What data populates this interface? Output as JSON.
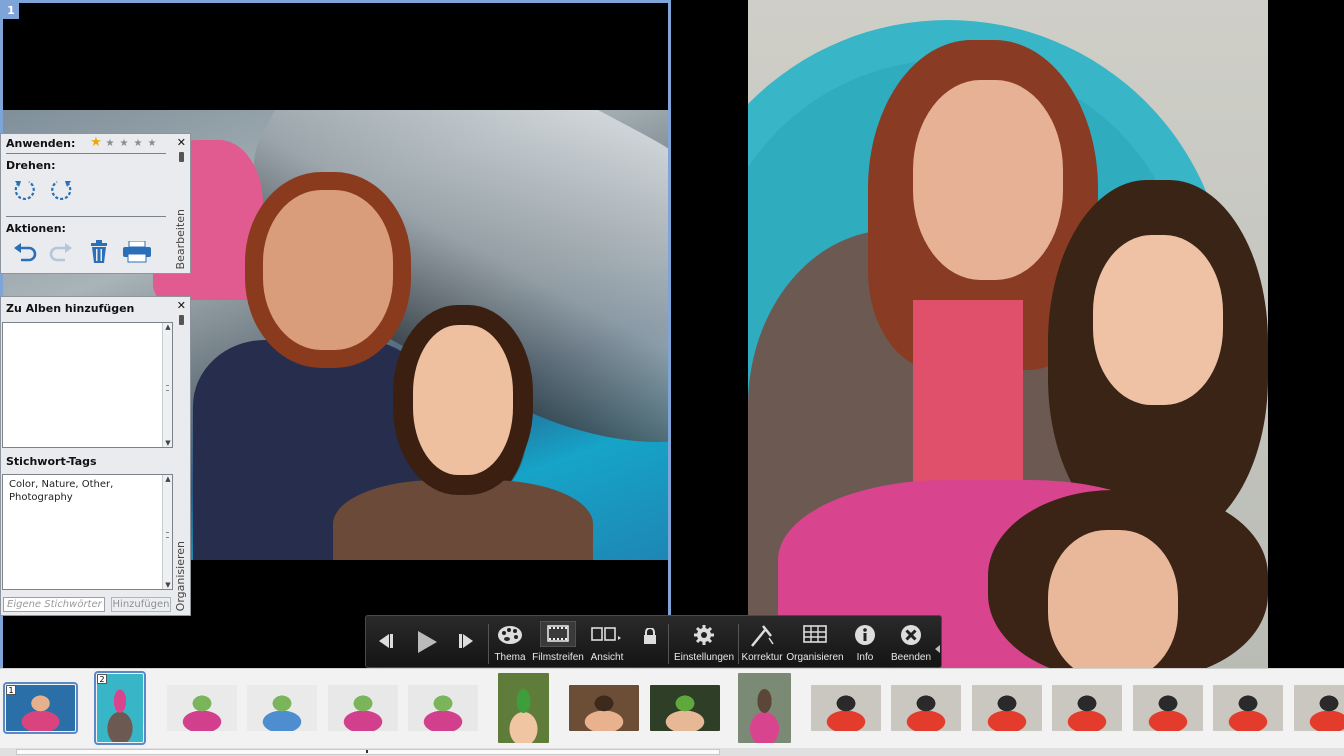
{
  "pane1": {
    "number": "1"
  },
  "edit_panel": {
    "apply_label": "Anwenden:",
    "rating_stars": [
      "★",
      "★",
      "★",
      "★",
      "★"
    ],
    "rating_value": 1,
    "rotate_label": "Drehen:",
    "actions_label": "Aktionen:",
    "tab_label": "Bearbeiten",
    "close_glyph": "✕"
  },
  "organize_panel": {
    "albums_label": "Zu Alben hinzufügen",
    "tags_label": "Stichwort-Tags",
    "tags_value": "Color,  Nature,  Other, Photography",
    "tag_input_placeholder": "Eigene Stichwörter",
    "add_button": "Hinzufügen",
    "tab_label": "Organisieren",
    "close_glyph": "✕"
  },
  "toolbar": {
    "buttons": [
      {
        "label": ""
      },
      {
        "label": ""
      },
      {
        "label": ""
      },
      {
        "label": "Thema"
      },
      {
        "label": "Filmstreifen"
      },
      {
        "label": "Ansicht"
      },
      {
        "label": ""
      },
      {
        "label": "Einstellungen"
      },
      {
        "label": "Korrektur"
      },
      {
        "label": "Organisieren"
      },
      {
        "label": "Info"
      },
      {
        "label": "Beenden"
      }
    ]
  },
  "filmstrip": {
    "thumbs": [
      {
        "badge": "1",
        "colors": [
          "#2a6fa8",
          "#d9447e",
          "#e6b08d"
        ]
      },
      {
        "badge": "2",
        "colors": [
          "#38b6c7",
          "#6c5a52",
          "#d9448e"
        ]
      },
      {
        "badge": "",
        "colors": [
          "#eaeaea",
          "#d23f8c",
          "#7ab55c"
        ]
      },
      {
        "badge": "",
        "colors": [
          "#eaeaea",
          "#4e8ed0",
          "#7ab55c"
        ]
      },
      {
        "badge": "",
        "colors": [
          "#e8e8e8",
          "#d23f8c",
          "#7ab55c"
        ]
      },
      {
        "badge": "",
        "colors": [
          "#e8e8e8",
          "#d23f8c",
          "#7ab55c"
        ]
      },
      {
        "badge": "",
        "colors": [
          "#5f7c3a",
          "#f0c6a2",
          "#3f9e3c"
        ]
      },
      {
        "badge": "",
        "colors": [
          "#6c4d35",
          "#e9b28e",
          "#3d2a1d"
        ]
      },
      {
        "badge": "",
        "colors": [
          "#2f3e27",
          "#e6b896",
          "#5fa83b"
        ]
      },
      {
        "badge": "",
        "colors": [
          "#7b8a74",
          "#d9448e",
          "#5b4638"
        ]
      },
      {
        "badge": "",
        "colors": [
          "#c9c7c0",
          "#e43c2c",
          "#2a2a2a"
        ]
      },
      {
        "badge": "",
        "colors": [
          "#c9c7c0",
          "#e43c2c",
          "#2a2a2a"
        ]
      },
      {
        "badge": "",
        "colors": [
          "#c9c7c0",
          "#e43c2c",
          "#2a2a2a"
        ]
      },
      {
        "badge": "",
        "colors": [
          "#c9c7c0",
          "#e43c2c",
          "#2a2a2a"
        ]
      },
      {
        "badge": "",
        "colors": [
          "#c9c7c0",
          "#e43c2c",
          "#2a2a2a"
        ]
      },
      {
        "badge": "",
        "colors": [
          "#c9c7c0",
          "#e43c2c",
          "#2a2a2a"
        ]
      },
      {
        "badge": "",
        "colors": [
          "#c9c7c0",
          "#e43c2c",
          "#2a2a2a"
        ]
      }
    ]
  },
  "colors": {
    "accent": "#7fa4d8",
    "toolbar_bg": "#1c1c1c",
    "panel_bg": "#e9ebee",
    "star_on": "#f0a800"
  }
}
